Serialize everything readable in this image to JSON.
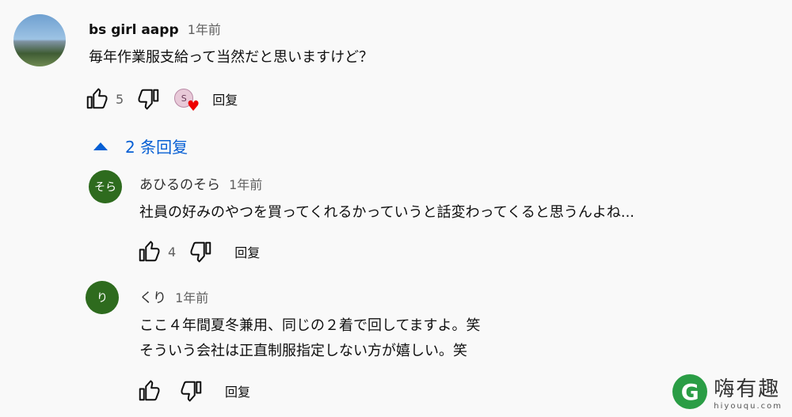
{
  "comments": [
    {
      "author": "bs girl aapp",
      "time": "1年前",
      "text": "毎年作業服支給って当然だと思いますけど？",
      "likes": "5",
      "reply_label": "回复",
      "creator_heart": true
    }
  ],
  "replies_toggle": "2 条回复",
  "replies": [
    {
      "avatar_letter": "そら",
      "author": "あひるのそら",
      "time": "1年前",
      "text": "社員の好みのやつを買ってくれるかっていうと話変わってくると思うんよね...",
      "likes": "4",
      "reply_label": "回复"
    },
    {
      "avatar_letter": "り",
      "author": "くり",
      "time": "1年前",
      "text_line1": "ここ４年間夏冬兼用、同じの２着で回してますよ。笑",
      "text_line2": "そういう会社は正直制服指定しない方が嬉しい。笑",
      "likes": "",
      "reply_label": "回复"
    }
  ],
  "icons": {
    "like": "thumb-up-icon",
    "dislike": "thumb-down-icon",
    "collapse": "triangle-up-icon",
    "heart": "heart-icon"
  },
  "colors": {
    "background": "#f9f9f9",
    "link_blue": "#065fd4",
    "avatar_green": "#2e6b1e",
    "heart_red": "#ee0000"
  },
  "watermark": {
    "name": "嗨有趣",
    "url": "hiyouqu.com",
    "logo_letter": "G"
  }
}
